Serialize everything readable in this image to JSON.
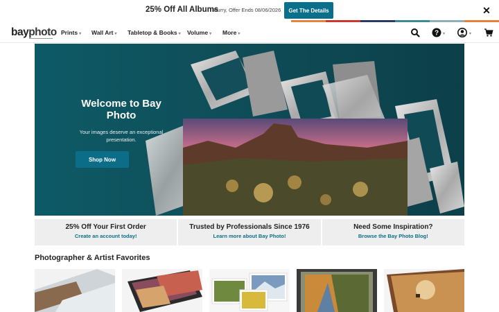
{
  "promo": {
    "title": "25% Off All Albums",
    "subtitle": "Hurry, Offer Ends 08/06/2026",
    "button": "Get The Details",
    "close": "✕"
  },
  "colors": {
    "accent": "#0a6f8a",
    "stripes": [
      "#e6833a",
      "#c9392f",
      "#2b3a62",
      "#3d8a91",
      "#8fb0b9",
      "#f0f0f0"
    ]
  },
  "nav": {
    "logo_a": "bay",
    "logo_b": "photo",
    "items": [
      "Prints",
      "Wall Art",
      "Tabletop & Books",
      "Volume",
      "More"
    ],
    "icons": [
      "search-icon",
      "help-icon",
      "account-icon",
      "cart-icon"
    ]
  },
  "hero": {
    "title": "Welcome to Bay Photo",
    "text": "Your images deserve an exceptional presentation.",
    "button": "Shop Now"
  },
  "info": [
    {
      "title": "25% Off Your First Order",
      "link": "Create an account today!"
    },
    {
      "title": "Trusted by Professionals Since 1976",
      "link": "Learn more about Bay Photo!"
    },
    {
      "title": "Need Some Inspiration?",
      "link": "Browse the Bay Photo Blog!"
    }
  ],
  "favorites": {
    "title": "Photographer & Artist Favorites"
  }
}
